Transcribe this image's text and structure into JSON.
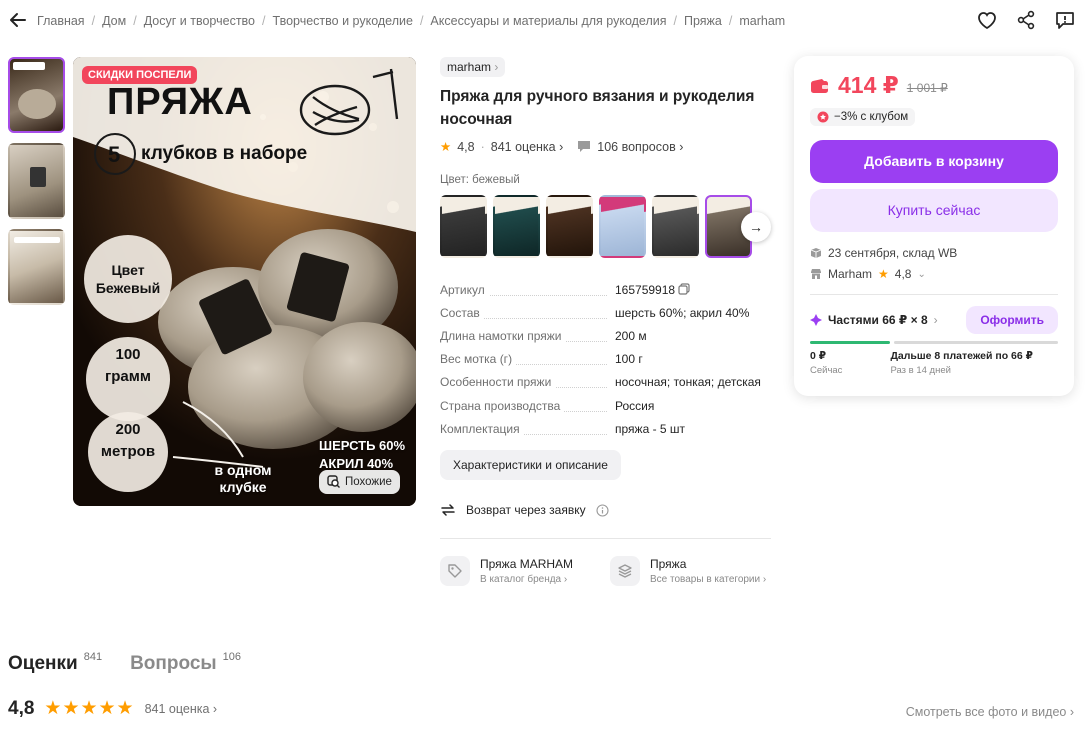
{
  "breadcrumbs": [
    "Главная",
    "Дом",
    "Досуг и творчество",
    "Творчество и рукоделие",
    "Аксессуары и материалы для рукоделия",
    "Пряжа",
    "marham"
  ],
  "product": {
    "brand": "marham",
    "title": "Пряжа для ручного вязания и рукоделия носочная",
    "rating": "4,8",
    "reviews": "841 оценка",
    "questions": "106 вопросов",
    "color_label": "Цвет: бежевый",
    "characteristics_button": "Характеристики и описание",
    "return_text": "Возврат через заявку"
  },
  "main_image": {
    "badge": "СКИДКИ ПОСПЕЛИ",
    "headline": "ПРЯЖА",
    "count": "5",
    "count_text": "клубков в наборе",
    "color_text": "Цвет Бежевый",
    "weight_text": "100 грамм",
    "length_text": "200 метров",
    "one_ball_text": "в одном клубке",
    "composition_text": "ШЕРСТЬ 60% АКРИЛ 40%",
    "similar_button": "Похожие"
  },
  "specs": [
    {
      "key": "Артикул",
      "value": "165759918"
    },
    {
      "key": "Состав",
      "value": "шерсть 60%; акрил 40%"
    },
    {
      "key": "Длина намотки пряжи",
      "value": "200 м"
    },
    {
      "key": "Вес мотка (г)",
      "value": "100 г"
    },
    {
      "key": "Особенности пряжи",
      "value": "носочная; тонкая; детская"
    },
    {
      "key": "Страна производства",
      "value": "Россия"
    },
    {
      "key": "Комплектация",
      "value": "пряжа - 5 шт"
    }
  ],
  "categories": [
    {
      "title": "Пряжа MARHAM",
      "subtitle": "В каталог бренда"
    },
    {
      "title": "Пряжа",
      "subtitle": "Все товары в категории"
    }
  ],
  "buybox": {
    "price": "414 ₽",
    "old_price": "1 001 ₽",
    "club_discount": "−3% с клубом",
    "add_to_cart": "Добавить в корзину",
    "buy_now": "Купить сейчас",
    "delivery": "23 сентября, склад WB",
    "seller": "Marham",
    "seller_rating": "4,8",
    "installments": "Частями 66 ₽ × 8",
    "installments_button": "Оформить",
    "now_amount": "0 ₽",
    "now_label": "Сейчас",
    "later_text": "Дальше 8 платежей по 66 ₽",
    "later_label": "Раз в 14 дней"
  },
  "sections": {
    "reviews_tab": "Оценки",
    "reviews_count": "841",
    "questions_tab": "Вопросы",
    "questions_count": "106",
    "rating_big": "4,8",
    "rating_count": "841 оценка",
    "all_photos": "Смотреть все фото и видео"
  },
  "colors": {
    "accent": "#9b3ff2",
    "price": "#f2465c",
    "star": "#ff9d00"
  }
}
